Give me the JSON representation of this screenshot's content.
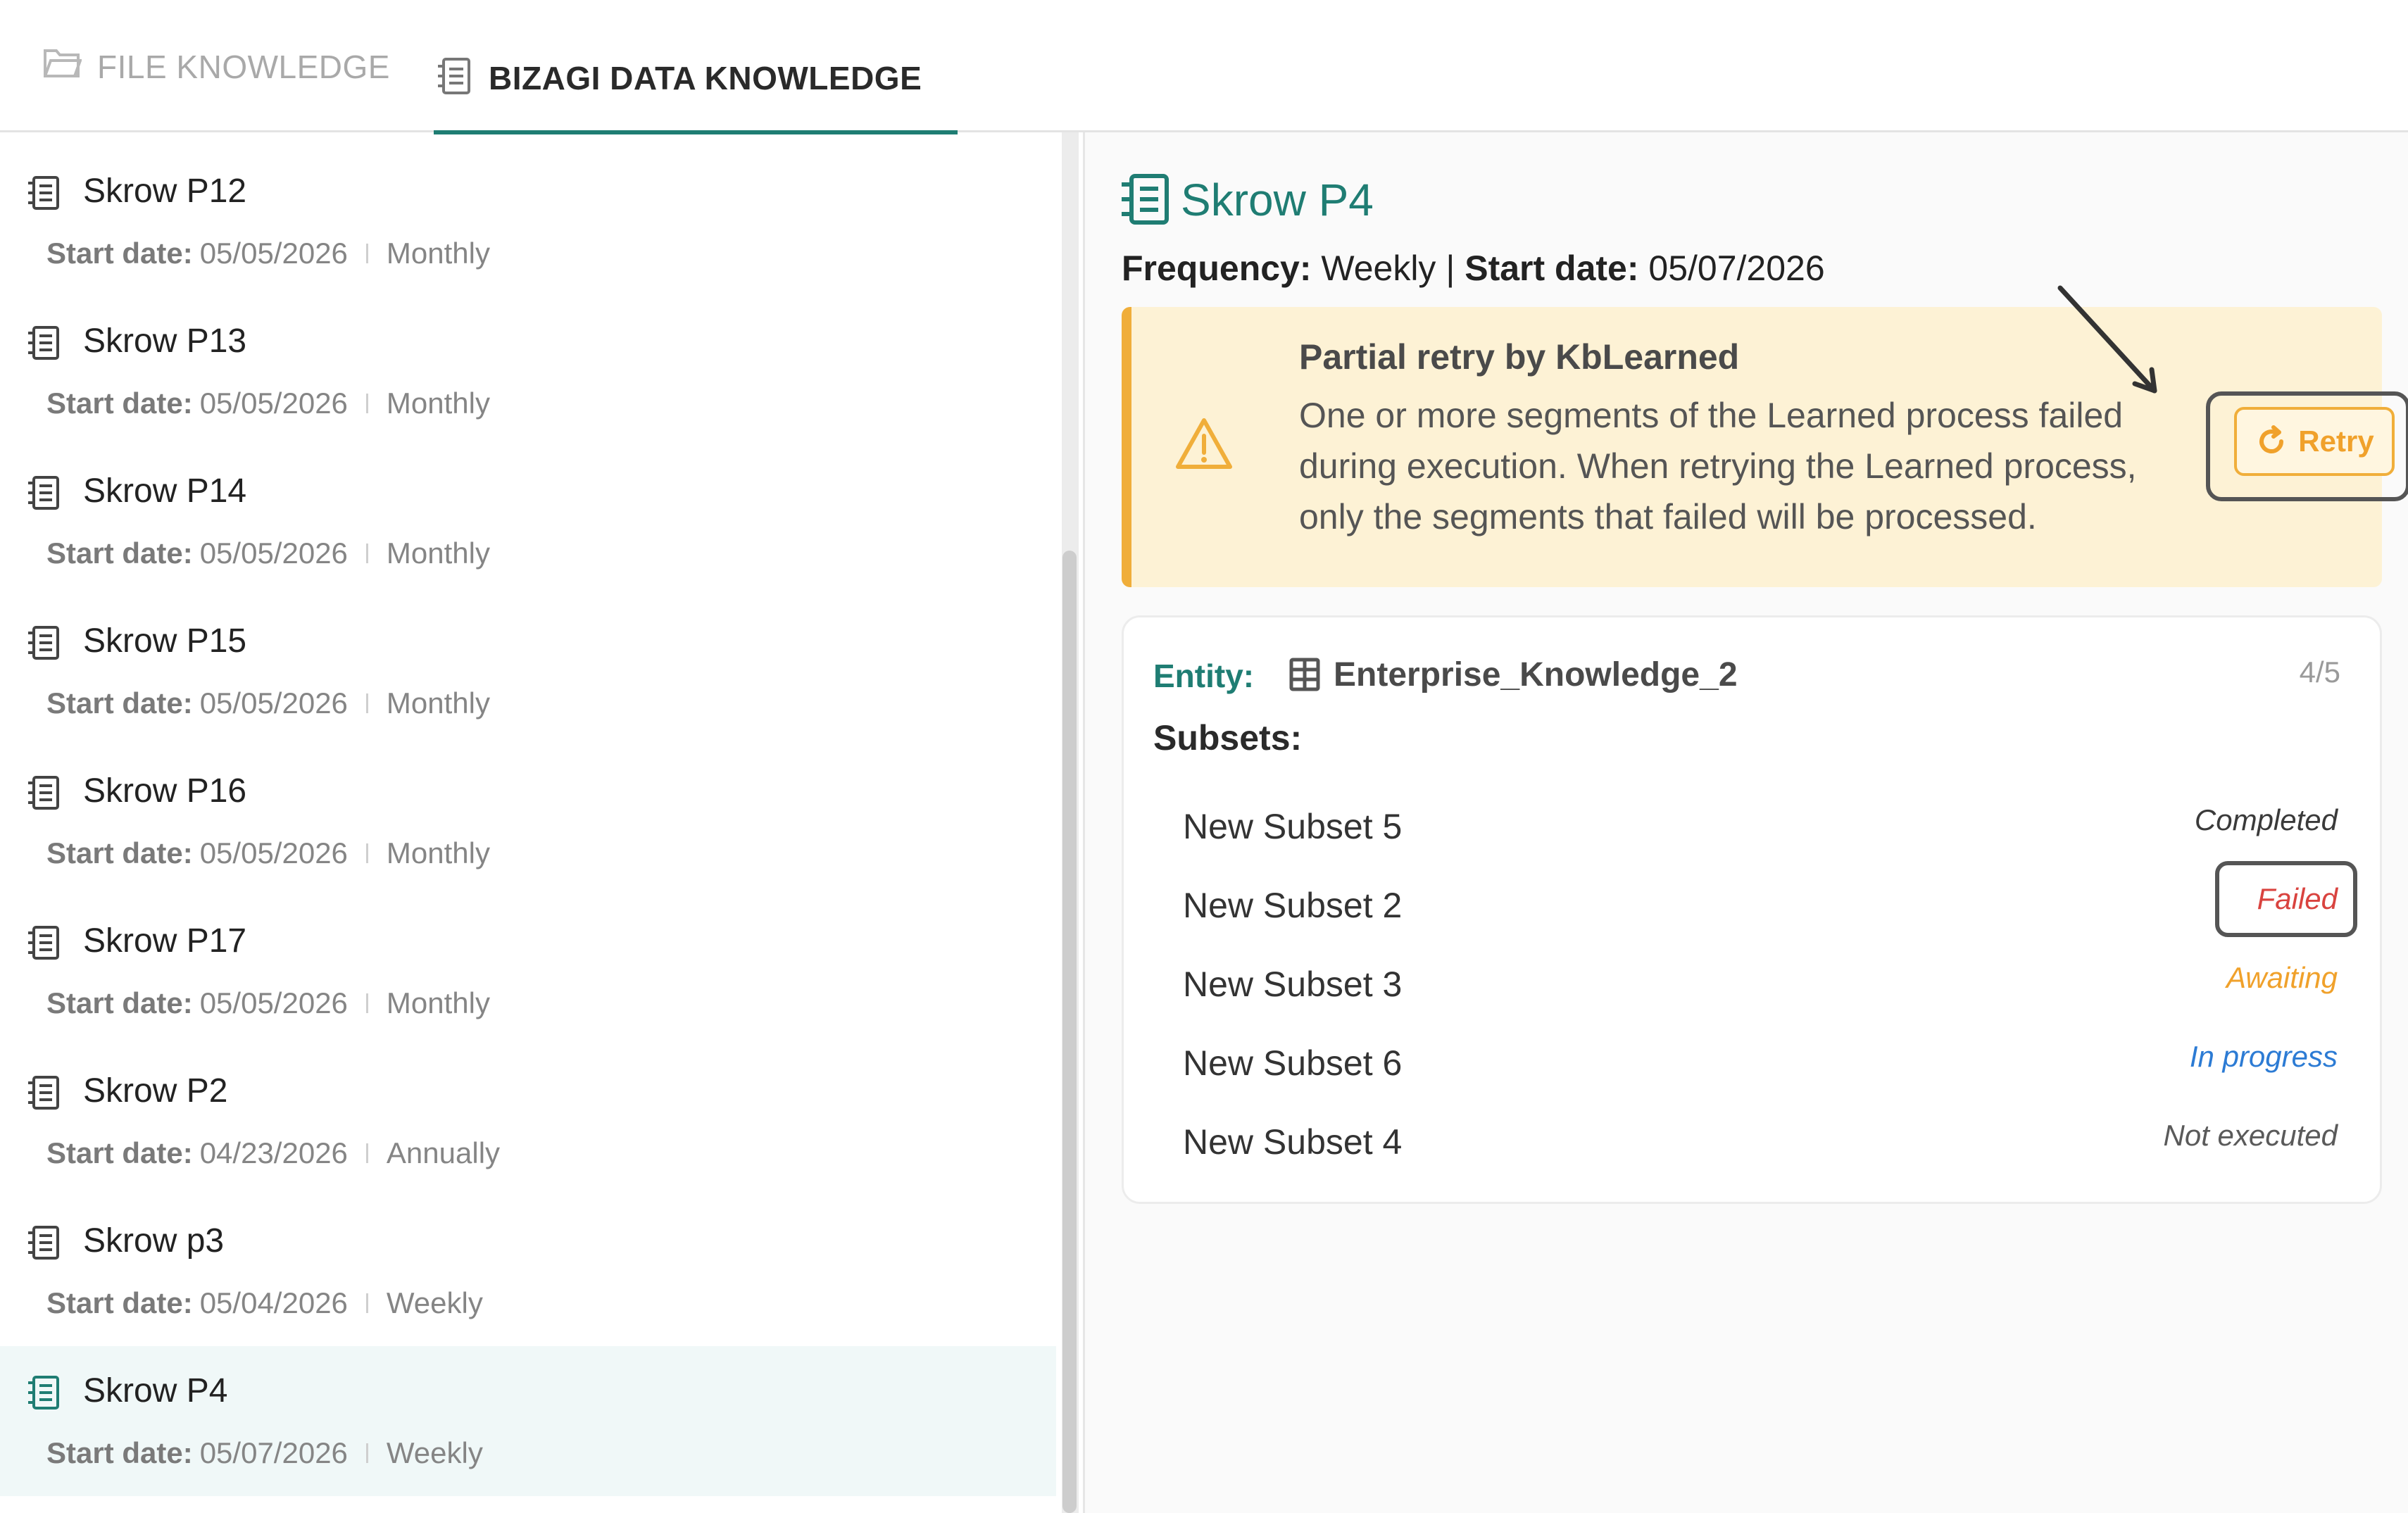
{
  "tabs": [
    {
      "label": "FILE KNOWLEDGE",
      "active": false
    },
    {
      "label": "BIZAGI DATA KNOWLEDGE",
      "active": true
    }
  ],
  "list": {
    "start_label": "Start date:",
    "items": [
      {
        "name": "Skrow P12",
        "start": "05/05/2026",
        "freq": "Monthly"
      },
      {
        "name": "Skrow P13",
        "start": "05/05/2026",
        "freq": "Monthly"
      },
      {
        "name": "Skrow P14",
        "start": "05/05/2026",
        "freq": "Monthly"
      },
      {
        "name": "Skrow P15",
        "start": "05/05/2026",
        "freq": "Monthly"
      },
      {
        "name": "Skrow P16",
        "start": "05/05/2026",
        "freq": "Monthly"
      },
      {
        "name": "Skrow P17",
        "start": "05/05/2026",
        "freq": "Monthly"
      },
      {
        "name": "Skrow P2",
        "start": "04/23/2026",
        "freq": "Annually"
      },
      {
        "name": "Skrow p3",
        "start": "05/04/2026",
        "freq": "Weekly"
      },
      {
        "name": "Skrow P4",
        "start": "05/07/2026",
        "freq": "Weekly",
        "selected": true
      }
    ]
  },
  "detail": {
    "title": "Skrow P4",
    "frequency_label": "Frequency:",
    "frequency_value": "Weekly",
    "separator": "|",
    "start_label": "Start date:",
    "start_value": "05/07/2026",
    "alert": {
      "title": "Partial retry by KbLearned",
      "message": "One or more segments of the Learned process failed during execution. When retrying the Learned process, only the segments that failed will be processed.",
      "retry_label": "Retry"
    },
    "card": {
      "entity_label": "Entity:",
      "entity_name": "Enterprise_Knowledge_2",
      "count": "4/5",
      "subsets_label": "Subsets:",
      "subsets": [
        {
          "name": "New Subset 5",
          "status": "Completed",
          "color": "#3a3a3a"
        },
        {
          "name": "New Subset 2",
          "status": "Failed",
          "color": "#d9433f",
          "highlighted": true
        },
        {
          "name": "New Subset 3",
          "status": "Awaiting",
          "color": "#f0a12b"
        },
        {
          "name": "New Subset 6",
          "status": "In progress",
          "color": "#2c7bd4"
        },
        {
          "name": "New Subset 4",
          "status": "Not executed",
          "color": "#5a5a5a"
        }
      ]
    }
  },
  "colors": {
    "accent": "#1f7d73",
    "warning": "#f0ae3a",
    "alert_bg": "#fdf2d5"
  }
}
